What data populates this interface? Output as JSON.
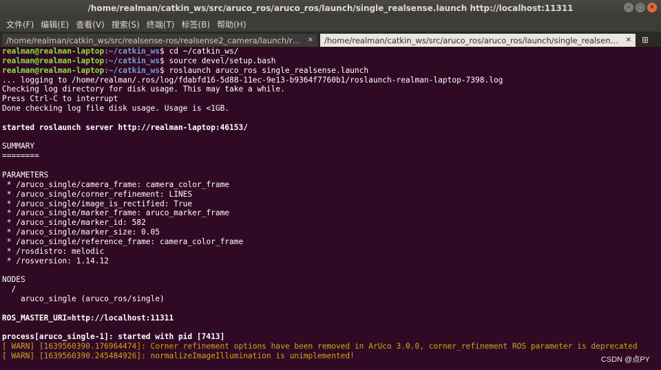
{
  "window": {
    "title": "/home/realman/catkin_ws/src/aruco_ros/aruco_ros/launch/single_realsense.launch http://localhost:11311",
    "buttons": [
      "minimize-icon",
      "maximize-icon",
      "close-icon"
    ]
  },
  "menu": [
    "文件(F)",
    "编辑(E)",
    "查看(V)",
    "搜索(S)",
    "终端(T)",
    "标签(B)",
    "帮助(H)"
  ],
  "tabs": [
    {
      "label": "/home/realman/catkin_ws/src/realsense-ros/realsense2_camera/launch/rs_came…",
      "active": false
    },
    {
      "label": "/home/realman/catkin_ws/src/aruco_ros/aruco_ros/launch/single_realsense.laun…",
      "active": true
    }
  ],
  "terminal": {
    "prompt_user": "realman@realman-laptop",
    "prompt_path": ":~/catkin_ws",
    "prompt_symbol": "$ ",
    "commands": [
      "cd ~/catkin_ws/",
      "source devel/setup.bash",
      "roslaunch aruco_ros single_realsense.launch"
    ],
    "output": [
      "... logging to /home/realman/.ros/log/fdabfd16-5d88-11ec-9e13-b9364f7760b1/roslaunch-realman-laptop-7398.log",
      "Checking log directory for disk usage. This may take a while.",
      "Press Ctrl-C to interrupt",
      "Done checking log file disk usage. Usage is <1GB.",
      "",
      "started roslaunch server http://realman-laptop:46153/",
      "",
      "SUMMARY",
      "========",
      "",
      "PARAMETERS",
      " * /aruco_single/camera_frame: camera_color_frame",
      " * /aruco_single/corner_refinement: LINES",
      " * /aruco_single/image_is_rectified: True",
      " * /aruco_single/marker_frame: aruco_marker_frame",
      " * /aruco_single/marker_id: 582",
      " * /aruco_single/marker_size: 0.05",
      " * /aruco_single/reference_frame: camera_color_frame",
      " * /rosdistro: melodic",
      " * /rosversion: 1.14.12",
      "",
      "NODES",
      "  /",
      "    aruco_single (aruco_ros/single)",
      "",
      "ROS_MASTER_URI=http://localhost:11311",
      "",
      "process[aruco_single-1]: started with pid [7413]",
      "[ WARN] [1639560390.176964474]: Corner refinement options have been removed in ArUco 3.0.0, corner_refinement ROS parameter is deprecated",
      "[ WARN] [1639560390.245484926]: normalizeImageIllumination is unimplemented!"
    ]
  },
  "watermark": "CSDN @点PY",
  "colors": {
    "background": "#300a24",
    "prompt_user": "#8ae234",
    "prompt_path": "#729fcf",
    "warning": "#d2a500"
  }
}
